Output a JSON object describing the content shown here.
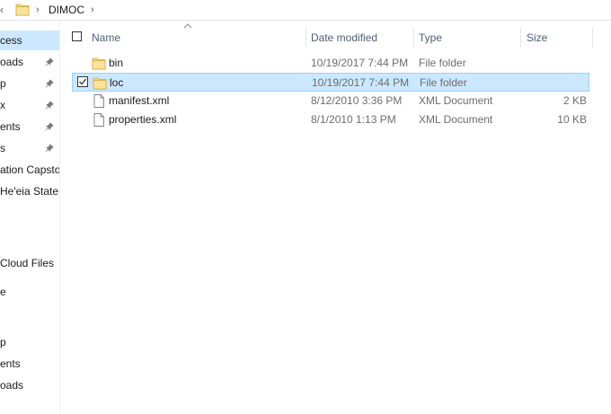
{
  "address": {
    "crumb": "DIMOC",
    "sep_glyph": "›"
  },
  "nav": {
    "items": [
      {
        "label": "cess",
        "pinned": false,
        "selected": true
      },
      {
        "label": "oads",
        "pinned": true,
        "selected": false
      },
      {
        "label": "p",
        "pinned": true,
        "selected": false
      },
      {
        "label": "x",
        "pinned": true,
        "selected": false
      },
      {
        "label": "ents",
        "pinned": true,
        "selected": false
      },
      {
        "label": "s",
        "pinned": true,
        "selected": false
      },
      {
        "label": "ation Capsto",
        "pinned": false,
        "selected": false
      },
      {
        "label": "He'eia State",
        "pinned": false,
        "selected": false
      },
      {
        "label": "Cloud Files",
        "pinned": false,
        "selected": false
      },
      {
        "label": "e",
        "pinned": false,
        "selected": false
      },
      {
        "label": "p",
        "pinned": false,
        "selected": false
      },
      {
        "label": "ents",
        "pinned": false,
        "selected": false
      },
      {
        "label": "oads",
        "pinned": false,
        "selected": false
      }
    ]
  },
  "columns": {
    "name": "Name",
    "date": "Date modified",
    "type": "Type",
    "size": "Size"
  },
  "files": [
    {
      "name": "bin",
      "date": "10/19/2017 7:44 PM",
      "type": "File folder",
      "size": "",
      "icon": "folder-icon",
      "selected": false
    },
    {
      "name": "loc",
      "date": "10/19/2017 7:44 PM",
      "type": "File folder",
      "size": "",
      "icon": "folder-icon",
      "selected": true
    },
    {
      "name": "manifest.xml",
      "date": "8/12/2010 3:36 PM",
      "type": "XML Document",
      "size": "2 KB",
      "icon": "file-icon",
      "selected": false
    },
    {
      "name": "properties.xml",
      "date": "8/1/2010 1:13 PM",
      "type": "XML Document",
      "size": "10 KB",
      "icon": "file-icon",
      "selected": false
    }
  ],
  "colors": {
    "selection": "#cce8ff",
    "selection_border": "#99d1ff",
    "header_text": "#4c607a",
    "folder": "#f8d775"
  }
}
